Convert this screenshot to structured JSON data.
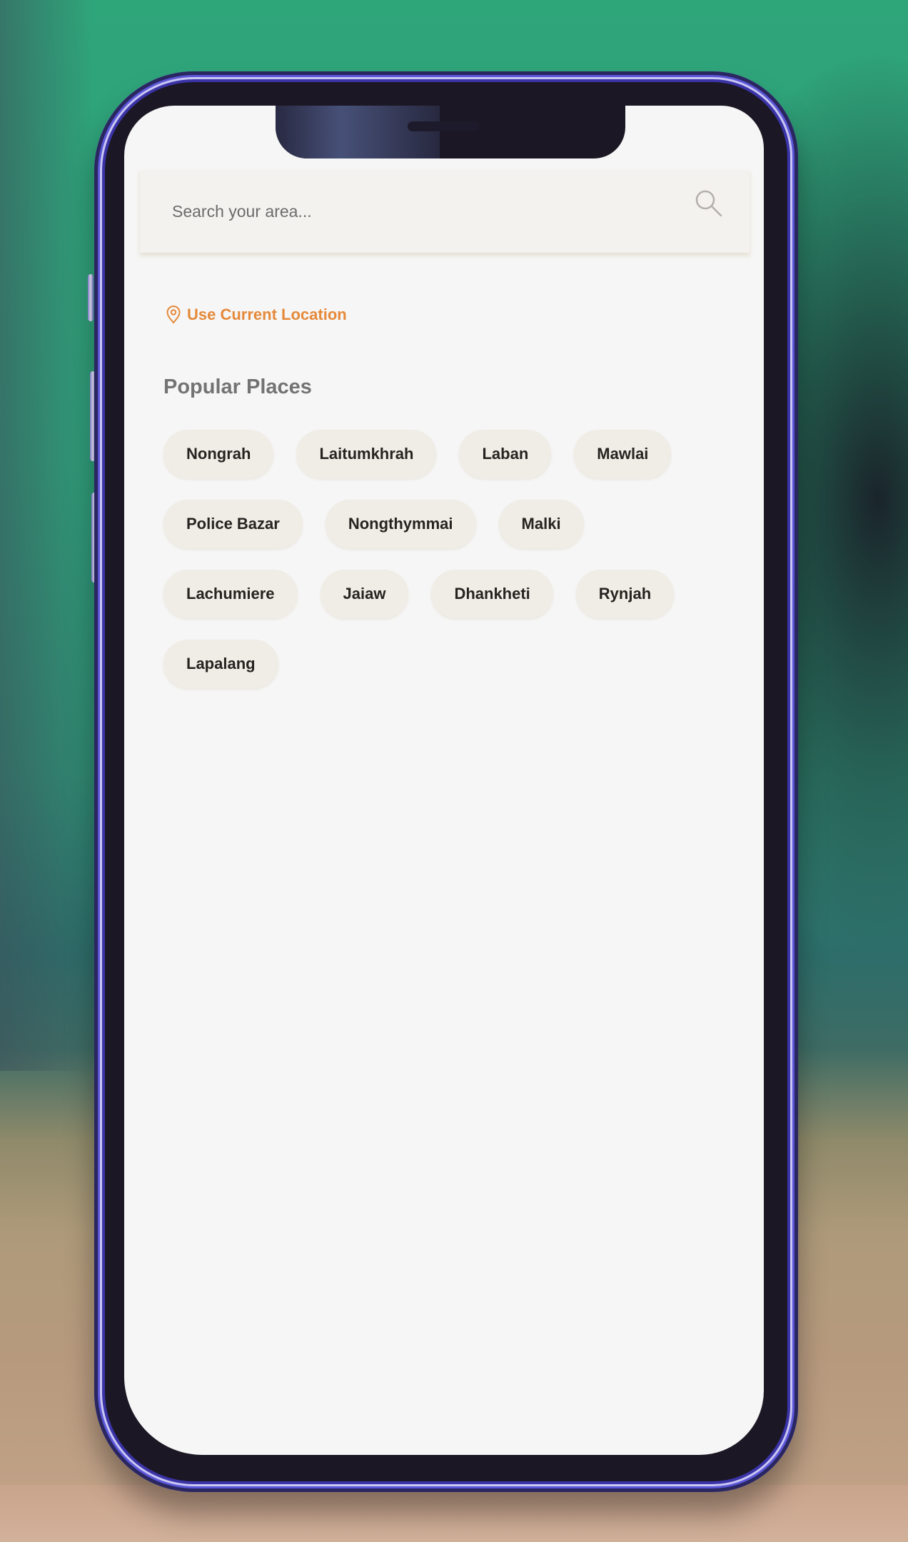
{
  "search": {
    "placeholder": "Search your area...",
    "value": "",
    "icon": "search-icon"
  },
  "location": {
    "label": "Use Current Location",
    "icon": "map-pin-icon",
    "color": "#e5893a"
  },
  "popular": {
    "title": "Popular Places",
    "places": [
      "Nongrah",
      "Laitumkhrah",
      "Laban",
      "Mawlai",
      "Police Bazar",
      "Nongthymmai",
      "Malki",
      "Lachumiere",
      "Jaiaw",
      "Dhankheti",
      "Rynjah",
      "Lapalang"
    ]
  },
  "colors": {
    "accent": "#e5893a",
    "chip_bg": "#f0ece6",
    "screen_bg": "#f6f6f6"
  }
}
